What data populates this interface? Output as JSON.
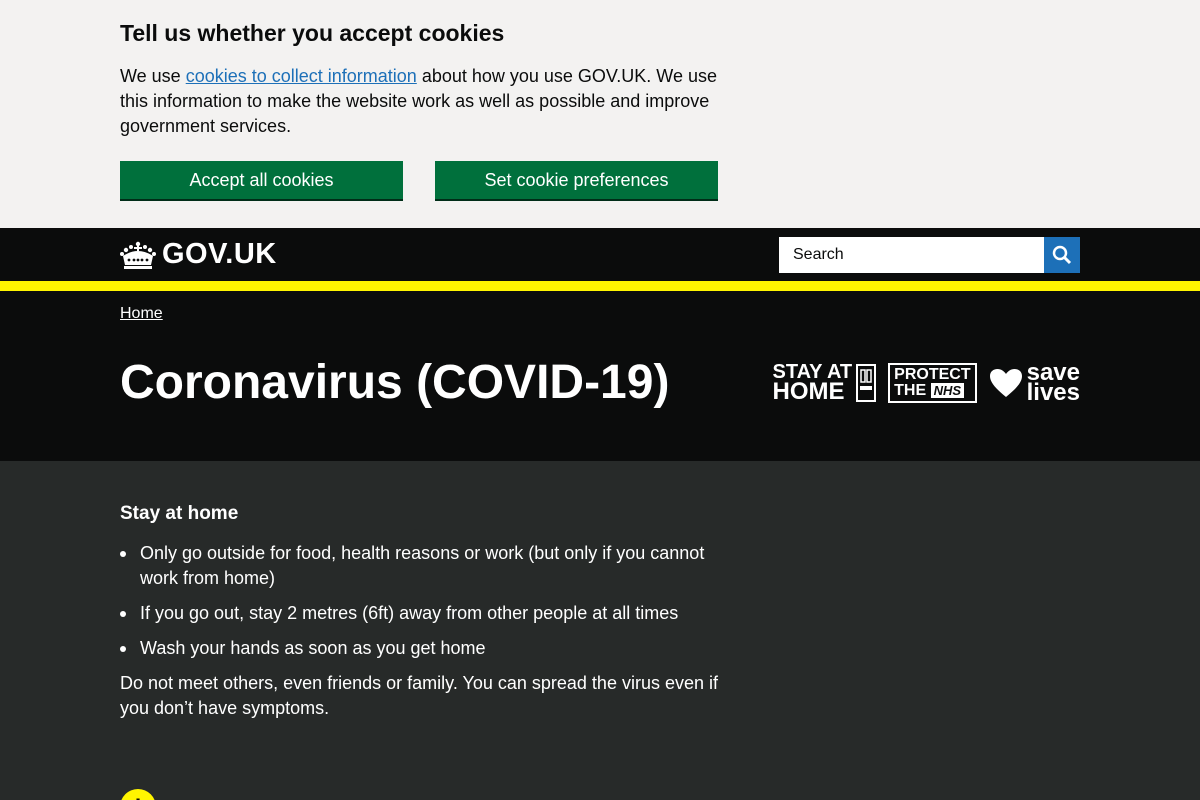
{
  "cookie_banner": {
    "title": "Tell us whether you accept cookies",
    "text_before": "We use ",
    "link": "cookies to collect information",
    "text_after": " about how you use GOV.UK. We use this information to make the website work as well as possible and improve government services.",
    "accept_label": "Accept all cookies",
    "preferences_label": "Set cookie preferences"
  },
  "header": {
    "logo_text": "GOV.UK",
    "search_placeholder": "Search"
  },
  "hero": {
    "breadcrumb": "Home",
    "title": "Coronavirus (COVID-19)",
    "logo_stay_line1": "STAY AT",
    "logo_stay_line2": "HOME",
    "logo_protect_line1": "PROTECT",
    "logo_protect_line2": "THE",
    "logo_nhs": "NHS",
    "logo_save_line1": "save",
    "logo_save_line2": "lives"
  },
  "main": {
    "section_title": "Stay at home",
    "bullets": [
      "Only go outside for food, health reasons or work (but only if you cannot work from home)",
      "If you go out, stay 2 metres (6ft) away from other people at all times",
      "Wash your hands as soon as you get home"
    ],
    "paragraph": "Do not meet others, even friends or family. You can spread the virus even if you don’t have symptoms.",
    "warning_glyph": "!"
  },
  "colors": {
    "cookie_bg": "#f3f2f1",
    "button_green": "#00703c",
    "header_black": "#0b0c0c",
    "yellow": "#fff500",
    "search_blue": "#1d70b8",
    "main_bg": "#272a29"
  }
}
